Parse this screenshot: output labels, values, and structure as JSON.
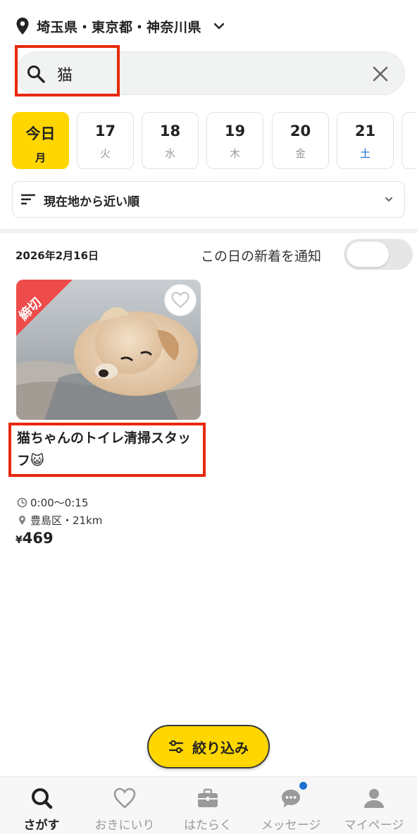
{
  "location": {
    "label": "埼玉県・東京都・神奈川県"
  },
  "search": {
    "value": "猫"
  },
  "dates": [
    {
      "num": "今日",
      "dow": "月",
      "active": true
    },
    {
      "num": "17",
      "dow": "火"
    },
    {
      "num": "18",
      "dow": "水"
    },
    {
      "num": "19",
      "dow": "木"
    },
    {
      "num": "20",
      "dow": "金"
    },
    {
      "num": "21",
      "dow": "土"
    }
  ],
  "sort": {
    "label": "現在地から近い順"
  },
  "list": {
    "date": "2026年2月16日",
    "notify_label": "この日の新着を通知",
    "notify_on": false
  },
  "job": {
    "badge": "締切",
    "title": "猫ちゃんのトイレ清掃スタッフ😺",
    "time": "0:00〜0:15",
    "place": "豊島区・21km",
    "price_symbol": "¥",
    "price": "469"
  },
  "filter_button": {
    "label": "絞り込み"
  },
  "nav": [
    {
      "label": "さがす",
      "icon": "search-icon",
      "active": true
    },
    {
      "label": "おきにいり",
      "icon": "heart-icon"
    },
    {
      "label": "はたらく",
      "icon": "briefcase-icon"
    },
    {
      "label": "メッセージ",
      "icon": "chat-icon",
      "badge": true
    },
    {
      "label": "マイページ",
      "icon": "person-icon"
    }
  ],
  "colors": {
    "accent": "#ffd600",
    "highlight": "#e8290b",
    "saturday": "#1b6fd1",
    "badge": "#ef4b4b"
  }
}
